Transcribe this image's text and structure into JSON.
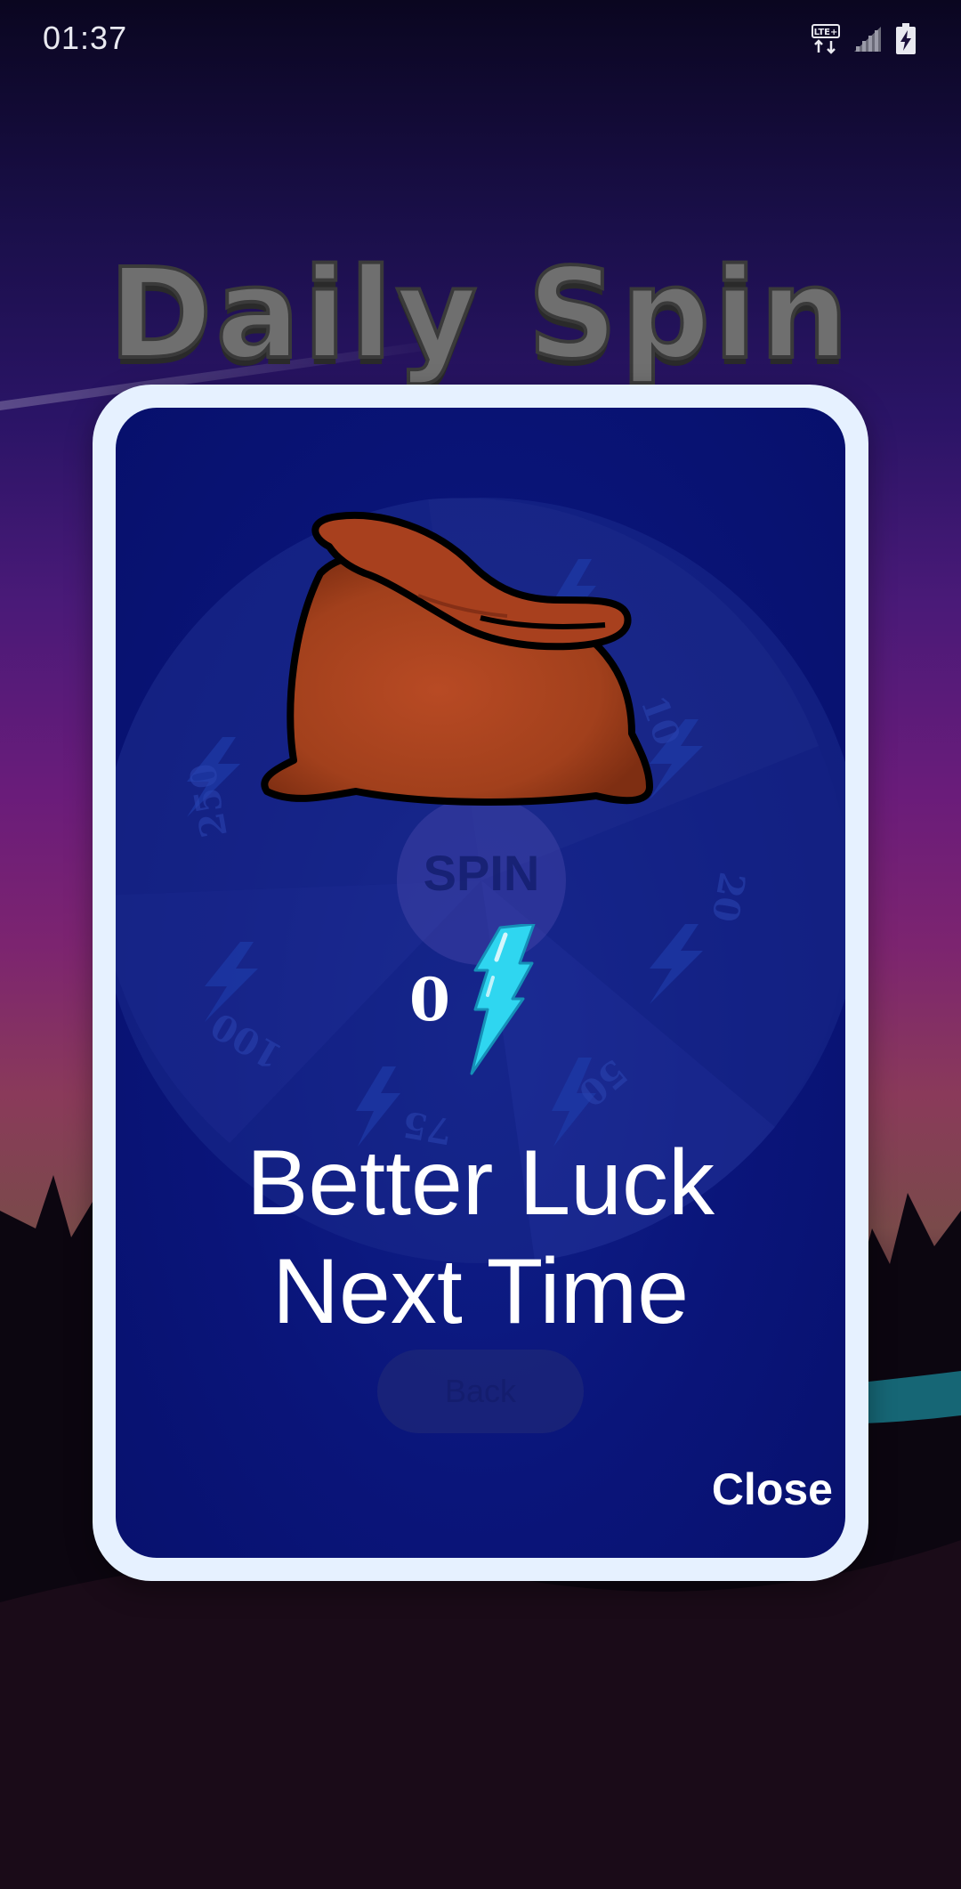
{
  "status_bar": {
    "time": "01:37",
    "network_badge": "LTE+",
    "icons": [
      "lte-icon",
      "signal-icon",
      "battery-charging-icon"
    ]
  },
  "screen_title": "Daily Spin",
  "wheel": {
    "segments": [
      "10",
      "20",
      "50",
      "75",
      "100",
      "250"
    ],
    "hub_label": "SPIN"
  },
  "back_button_label": "Back",
  "dialog": {
    "reward_icon": "bag-icon",
    "reward_amount": "0",
    "reward_currency_icon": "lightning-bolt-icon",
    "message_line1": "Better Luck",
    "message_line2": "Next Time",
    "close_label": "Close"
  },
  "colors": {
    "dialog_border": "#e6f1ff",
    "dialog_background": "#0a157a",
    "bolt": "#2fd6f0",
    "bag": "#a8401e",
    "title_fill": "#6f6f6f"
  }
}
